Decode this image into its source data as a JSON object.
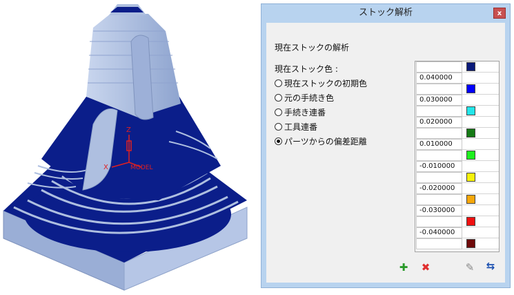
{
  "dialog": {
    "title": "ストック解析",
    "close_label": "x",
    "section_title": "現在ストックの解析",
    "color_label": "現在ストック色 :",
    "options": [
      {
        "label": "現在ストックの初期色",
        "selected": false
      },
      {
        "label": "元の手続き色",
        "selected": false
      },
      {
        "label": "手続き連番",
        "selected": false
      },
      {
        "label": "工具連番",
        "selected": false
      },
      {
        "label": "パーツからの偏差距離",
        "selected": true
      }
    ],
    "deviation_rows": [
      {
        "value": "",
        "color": "#0a1a7a"
      },
      {
        "value": "0.040000",
        "color": ""
      },
      {
        "value": "",
        "color": "#0000ff"
      },
      {
        "value": "0.030000",
        "color": ""
      },
      {
        "value": "",
        "color": "#22e6ea"
      },
      {
        "value": "0.020000",
        "color": ""
      },
      {
        "value": "",
        "color": "#157a15"
      },
      {
        "value": "0.010000",
        "color": ""
      },
      {
        "value": "",
        "color": "#1ef01e"
      },
      {
        "value": "-0.010000",
        "color": ""
      },
      {
        "value": "",
        "color": "#f6f20a"
      },
      {
        "value": "-0.020000",
        "color": ""
      },
      {
        "value": "",
        "color": "#f6a70a"
      },
      {
        "value": "-0.030000",
        "color": ""
      },
      {
        "value": "",
        "color": "#f01010"
      },
      {
        "value": "-0.040000",
        "color": ""
      },
      {
        "value": "",
        "color": "#6e0a0a"
      }
    ],
    "toolbar": {
      "add_icon": "plus-icon",
      "delete_icon": "delete-x-icon",
      "apply_icon": "apply-icon",
      "swap_icon": "swap-icon"
    }
  },
  "viewport": {
    "axis_z": "Z",
    "axis_x": "X",
    "model_label": "MODEL",
    "colors": {
      "stock_light": "#aebfe0",
      "stock_dark": "#0b1e8a",
      "axis": "#e02020"
    }
  }
}
